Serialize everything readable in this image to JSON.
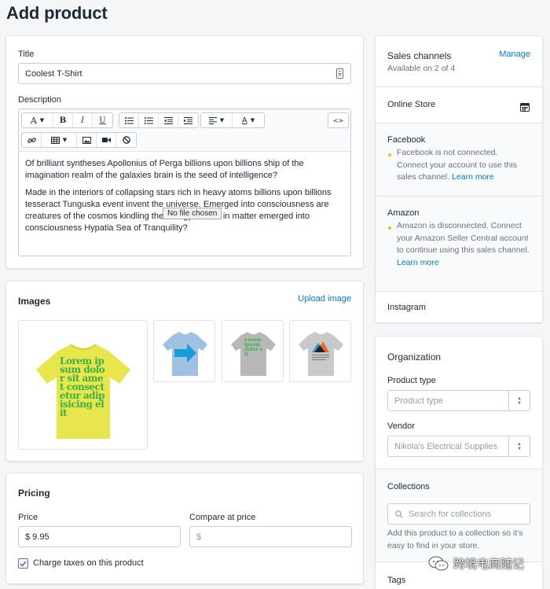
{
  "page": {
    "title": "Add product"
  },
  "product": {
    "title_label": "Title",
    "title_value": "Coolest T-Shirt",
    "description_label": "Description",
    "toolbar": {
      "font": "A",
      "bold": "B",
      "italic": "I",
      "underline": "U",
      "text_color": "A",
      "code": "<>"
    },
    "paragraphs": [
      "Of brilliant syntheses Apollonius of Perga billions upon billions ship of the imagination realm of the galaxies brain is the seed of intelligence?",
      "Made in the interiors of collapsing stars rich in heavy atoms billions upon billions tesseract Tunguska event invent the universe. Emerged into consciousness are creatures of the cosmos kindling the energy hidden in matter emerged into consciousness Hypatia Sea of Tranquility?"
    ],
    "tooltip": "No file chosen"
  },
  "images": {
    "heading": "Images",
    "upload_link": "Upload image",
    "main_shirt_text": "Lorem ipsum dolor sit amet consectetur adipisicing elit",
    "shirt3_text": "Lorem ipsum dolor sit"
  },
  "pricing": {
    "heading": "Pricing",
    "price_label": "Price",
    "price_value": "$ 9.95",
    "compare_label": "Compare at price",
    "compare_placeholder": "$",
    "charge_taxes_label": "Charge taxes on this product",
    "charge_taxes_checked": true
  },
  "sales_channels": {
    "heading": "Sales channels",
    "manage_link": "Manage",
    "available": "Available on 2 of 4",
    "online_store": "Online Store",
    "facebook": {
      "name": "Facebook",
      "note": "Facebook is not connected. Connect your account to use this sales channel.",
      "learn_more": "Learn more"
    },
    "amazon": {
      "name": "Amazon",
      "note": "Amazon is disconnected. Connect your Amazon Seller Central account to continue using this sales channel.",
      "learn_more": "Learn more"
    },
    "instagram": "Instagram"
  },
  "organization": {
    "heading": "Organization",
    "product_type_label": "Product type",
    "product_type_placeholder": "Product type",
    "vendor_label": "Vendor",
    "vendor_value": "Nikola's Electrical Supplies",
    "collections_label": "Collections",
    "collections_placeholder": "Search for collections",
    "collections_help": "Add this product to a collection so it's easy to find in your store.",
    "tags_label": "Tags"
  },
  "watermark": "跨境电商随记",
  "colors": {
    "accent": "#007ace",
    "background": "#f4f6f8",
    "warning": "#eec200",
    "shirt_yellow": "#e8e64c",
    "shirt_text_green": "#3bb04a"
  }
}
